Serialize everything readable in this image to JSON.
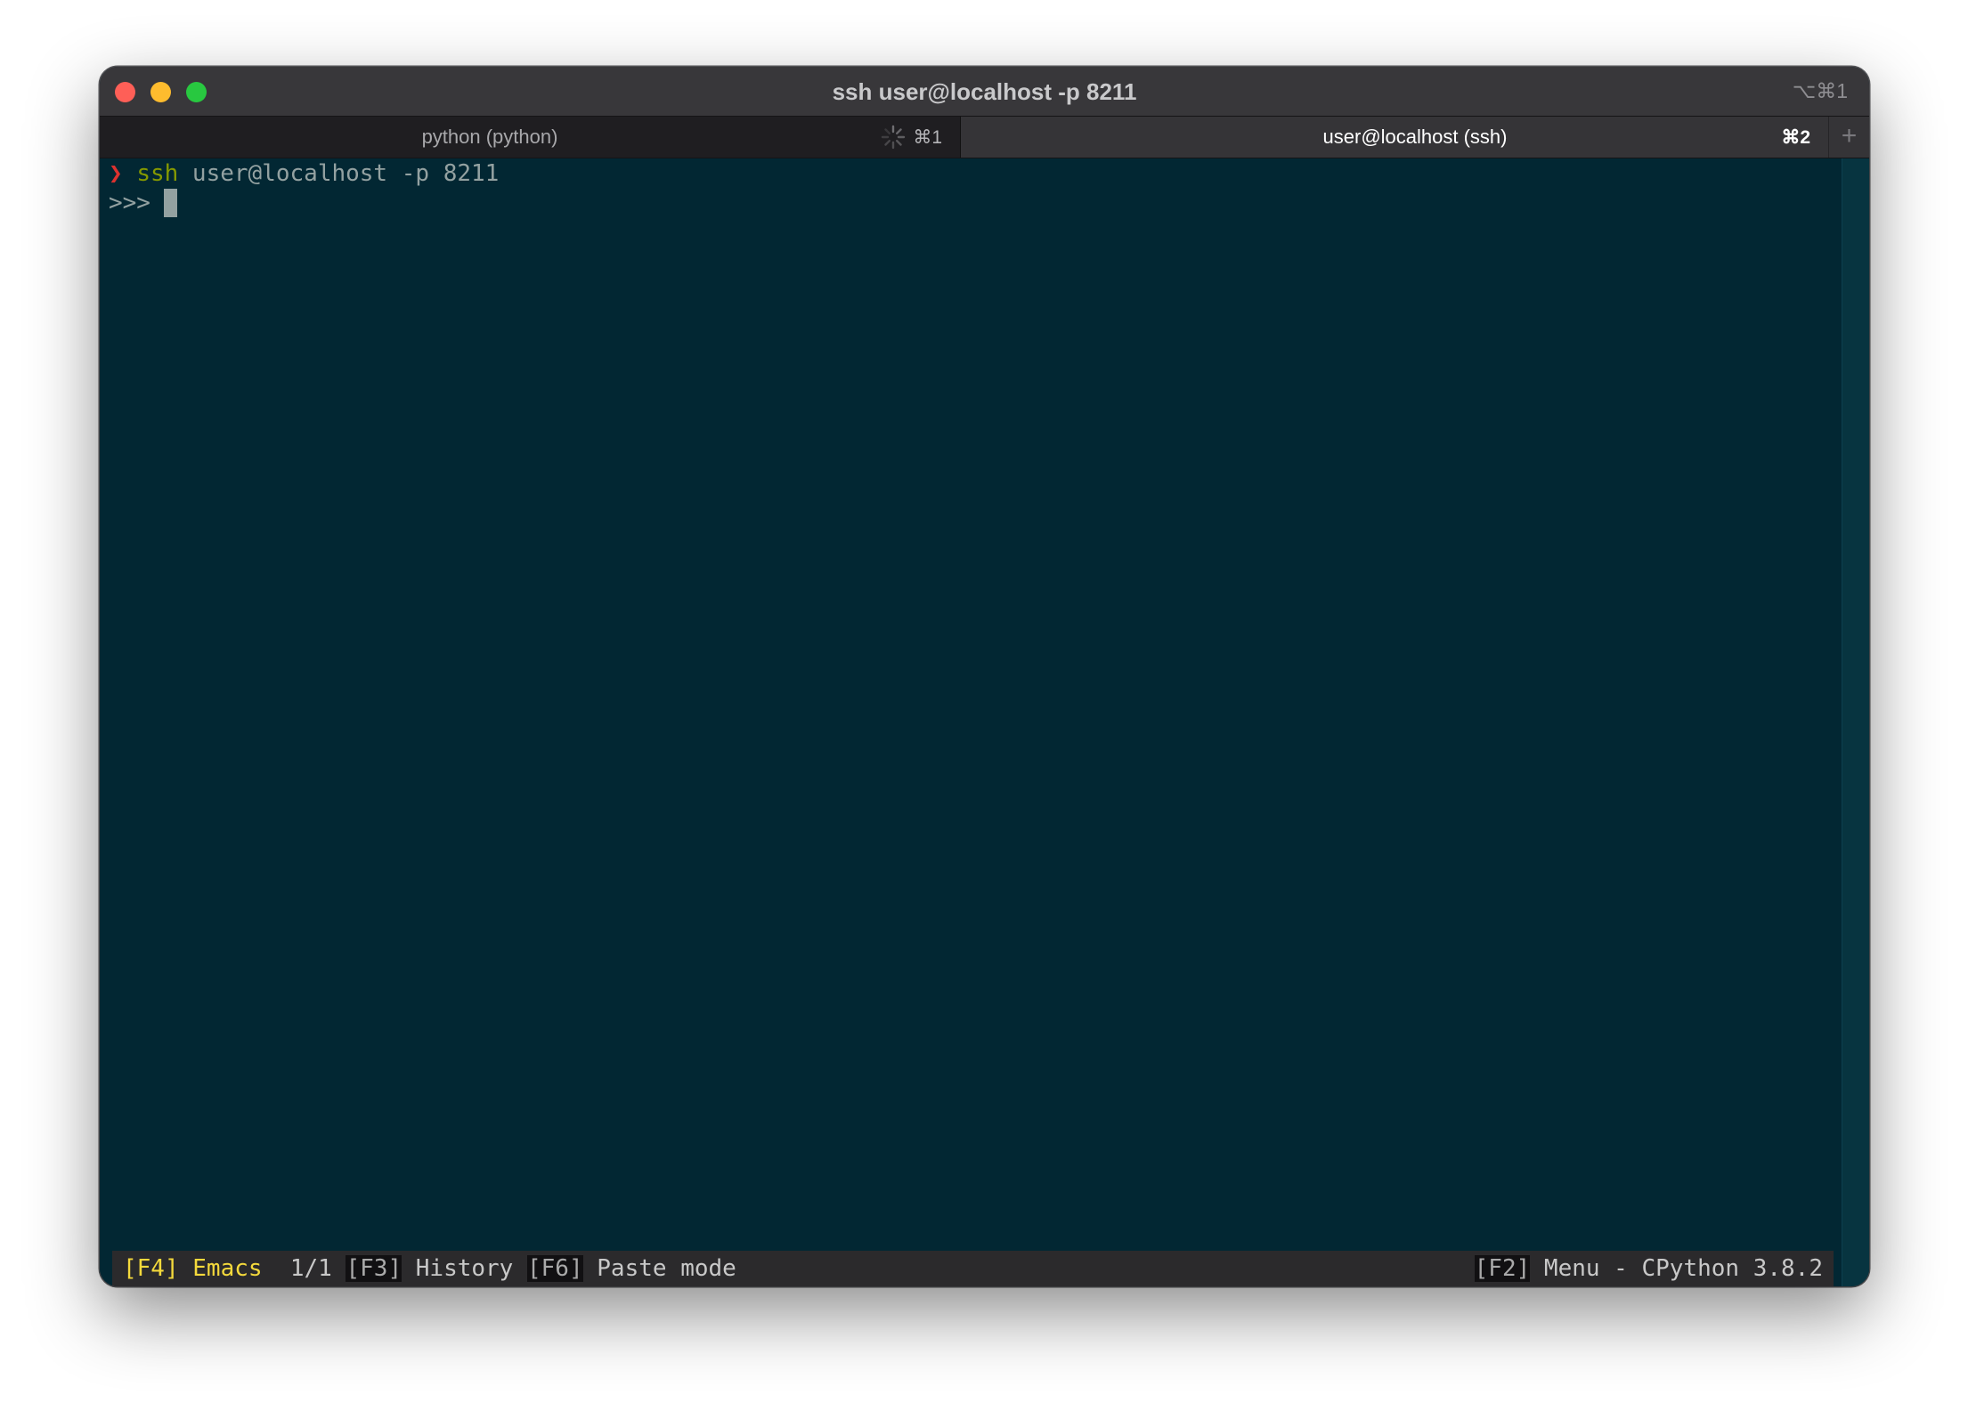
{
  "window": {
    "title": "ssh user@localhost -p 8211",
    "shortcut": "⌥⌘1"
  },
  "tabs": [
    {
      "label": "python (python)",
      "shortcut": "⌘1",
      "active": false,
      "busy": true
    },
    {
      "label": "user@localhost (ssh)",
      "shortcut": "⌘2",
      "active": true
    }
  ],
  "tab_add_label": "+",
  "terminal": {
    "prompt_symbol": "❯",
    "command_name": "ssh",
    "command_args": " user@localhost -p 8211",
    "repl_prompt": ">>>"
  },
  "statusbar": {
    "f4_key": "[F4]",
    "f4_label": " Emacs",
    "counter": "1/1",
    "f3_key": "[F3]",
    "f3_label": " History ",
    "f6_key": "[F6]",
    "f6_label": " Paste mode",
    "f2_key": "[F2]",
    "f2_label": " Menu - CPython 3.8.2"
  },
  "colors": {
    "terminal_bg": "#022733",
    "prompt_red": "#dc322f",
    "command_green": "#859900",
    "status_yellow": "#f4d93c"
  }
}
